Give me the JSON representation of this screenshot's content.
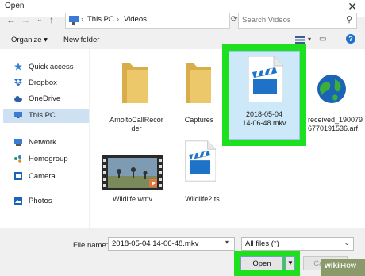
{
  "window": {
    "title": "Open",
    "close": "✕"
  },
  "nav": {
    "back": "←",
    "forward": "→",
    "recent": "⌄",
    "up": "↑"
  },
  "address": {
    "crumbs": [
      "This PC",
      "Videos"
    ],
    "separator": "›"
  },
  "search": {
    "placeholder": "Search Videos"
  },
  "toolbar": {
    "organize": "Organize ▾",
    "new_folder": "New folder"
  },
  "sidebar": {
    "items": [
      {
        "label": "Quick access"
      },
      {
        "label": "Dropbox"
      },
      {
        "label": "OneDrive"
      },
      {
        "label": "This PC"
      },
      {
        "label": "Network"
      },
      {
        "label": "Homegroup"
      },
      {
        "label": "Camera"
      },
      {
        "label": "Photos"
      }
    ]
  },
  "files": [
    {
      "name_line1": "AmoltoCallRecor",
      "name_line2": "der",
      "icon": "folder-icon"
    },
    {
      "name_line1": "Captures",
      "name_line2": "",
      "icon": "folder-icon"
    },
    {
      "name_line1": "2018-05-04",
      "name_line2": "14-06-48.mkv",
      "icon": "video-clapper-icon"
    },
    {
      "name_line1": "received_190079",
      "name_line2": "6770191536.arf",
      "icon": "globe-icon"
    },
    {
      "name_line1": "Wildlife.wmv",
      "name_line2": "",
      "icon": "video-thumbnail"
    },
    {
      "name_line1": "Wildlife2.ts",
      "name_line2": "",
      "icon": "video-clapper-icon"
    }
  ],
  "bottom": {
    "file_name_label": "File name:",
    "file_name_value": "2018-05-04 14-06-48.mkv",
    "file_type_value": "All files (*)",
    "open_label": "Open",
    "cancel_label": "Cancel"
  },
  "watermark": {
    "a": "wiki",
    "b": "How"
  },
  "colors": {
    "highlight": "#1fe01f",
    "selection": "#cde8f8",
    "folder": "#e9c46a",
    "clapper": "#1e73c8"
  }
}
